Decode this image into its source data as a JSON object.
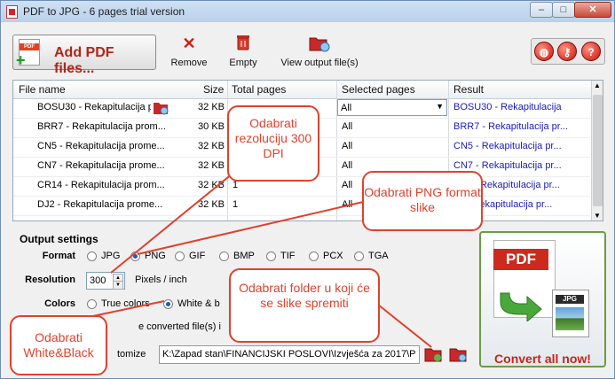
{
  "window": {
    "title": "PDF to JPG - 6 pages trial version",
    "minimize": "–",
    "maximize": "□",
    "close": "✕"
  },
  "toolbar": {
    "add_label": "Add PDF files...",
    "add_icon_text": "PDF",
    "remove_label": "Remove",
    "empty_label": "Empty",
    "view_label": "View output file(s)",
    "icons": [
      "remove-x-icon",
      "trash-icon",
      "folder-view-icon",
      "globe-icon",
      "key-icon",
      "help-icon"
    ],
    "help": "?"
  },
  "table": {
    "headers": [
      "File name",
      "Size",
      "Total pages",
      "Selected pages",
      "Result"
    ],
    "rows": [
      {
        "name": "BOSU30 - Rekapitulacija p",
        "size": "32 KB",
        "pages": "",
        "selected": "All",
        "result": "BOSU30 - Rekapitulacija"
      },
      {
        "name": "BRR7 - Rekapitulacija prom...",
        "size": "30 KB",
        "pages": "",
        "selected": "All",
        "result": "BRR7 - Rekapitulacija pr..."
      },
      {
        "name": "CN5 - Rekapitulacija prome...",
        "size": "32 KB",
        "pages": "",
        "selected": "All",
        "result": "CN5 - Rekapitulacija pr..."
      },
      {
        "name": "CN7 - Rekapitulacija prome...",
        "size": "32 KB",
        "pages": "",
        "selected": "All",
        "result": "CN7 - Rekapitulacija pr..."
      },
      {
        "name": "CR14 - Rekapitulacija prom...",
        "size": "32 KB",
        "pages": "1",
        "selected": "All",
        "result": "R14 - Rekapitulacija pr..."
      },
      {
        "name": "DJ2 - Rekapitulacija prome...",
        "size": "32 KB",
        "pages": "1",
        "selected": "All",
        "result": "J2 - Rekapitulacija pr..."
      }
    ]
  },
  "output": {
    "title": "Output settings",
    "format_label": "Format",
    "formats": [
      "JPG",
      "PNG",
      "GIF",
      "BMP",
      "TIF",
      "PCX",
      "TGA"
    ],
    "selected_format": "PNG",
    "resolution_label": "Resolution",
    "resolution_value": "300",
    "resolution_unit": "Pixels / inch",
    "colors_label": "Colors",
    "colors_options": [
      "True colors",
      "White & b"
    ],
    "selected_color": "White & b",
    "save_option": "e converted file(s) i",
    "customize_label": "tomize",
    "path": "K:\\Zapad stan\\FINANCIJSKI POSLOVI\\Izvješća za 2017\\P"
  },
  "convert": {
    "label": "Convert all now!",
    "pdf": "PDF",
    "jpg": "JPG"
  },
  "callouts": {
    "resolution": "Odabrati rezoluciju 300 DPI",
    "png": "Odabrati PNG format slike",
    "folder": "Odabrati folder u koji će se slike spremiti",
    "white": "Odabrati White&Black"
  },
  "colors": {
    "accent_red": "#e0412c",
    "result_blue": "#1a1ab8",
    "convert_green": "#6a9b47"
  }
}
